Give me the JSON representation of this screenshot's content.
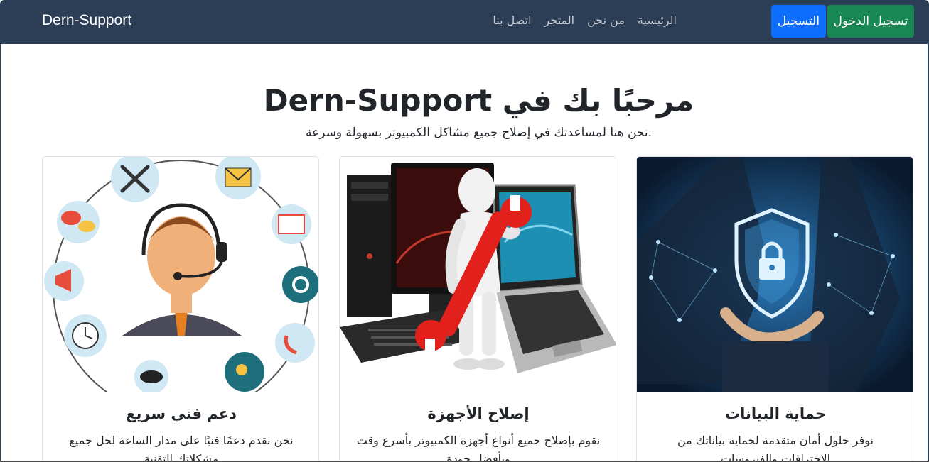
{
  "nav": {
    "brand": "Dern-Support",
    "links": [
      "الرئيسية",
      "من نحن",
      "المتجر",
      "اتصل بنا"
    ],
    "register_label": "التسجيل",
    "login_label": "تسجيل الدخول"
  },
  "hero": {
    "title": "مرحبًا بك في Dern-Support",
    "subtitle": "نحن هنا لمساعدتك في إصلاح جميع مشاكل الكمبيوتر بسهولة وسرعة."
  },
  "cards": [
    {
      "title": "دعم فني سريع",
      "text": "نحن نقدم دعمًا فنيًا على مدار الساعة لحل جميع مشكلاتك التقنية"
    },
    {
      "title": "إصلاح الأجهزة",
      "text": "نقوم بإصلاح جميع أنواع أجهزة الكمبيوتر بأسرع وقت وبأفضل جودة"
    },
    {
      "title": "حماية البيانات",
      "text": "نوفر حلول أمان متقدمة لحماية بياناتك من الاختراقات والفيروسات"
    }
  ],
  "colors": {
    "navbar": "#2b3e55",
    "register": "#0d6efd",
    "login": "#198754"
  }
}
